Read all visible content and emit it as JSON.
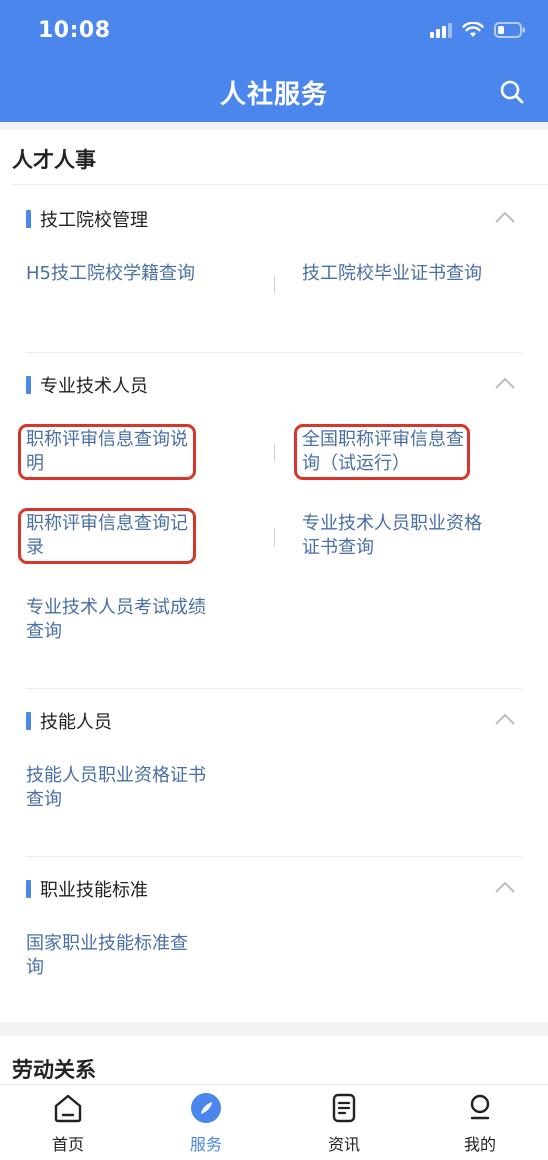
{
  "status_bar": {
    "time": "10:08"
  },
  "header": {
    "title": "人社服务",
    "search_icon": "search-icon"
  },
  "section_talent": {
    "title": "人才人事",
    "groups": [
      {
        "title": "技工院校管理",
        "items": [
          {
            "label": "H5技工院校学籍查询"
          },
          {
            "label": "技工院校毕业证书查询"
          }
        ]
      },
      {
        "title": "专业技术人员",
        "items": [
          {
            "label": "职称评审信息查询说明",
            "highlighted": true
          },
          {
            "label": "全国职称评审信息查询（试运行）",
            "highlighted": true
          },
          {
            "label": "职称评审信息查询记录",
            "highlighted": true
          },
          {
            "label": "专业技术人员职业资格证书查询"
          },
          {
            "label": "专业技术人员考试成绩查询"
          }
        ]
      },
      {
        "title": "技能人员",
        "items": [
          {
            "label": "技能人员职业资格证书查询"
          }
        ]
      },
      {
        "title": "职业技能标准",
        "items": [
          {
            "label": "国家职业技能标准查询"
          }
        ]
      }
    ]
  },
  "section_labor": {
    "title": "劳动关系"
  },
  "tabbar": {
    "active": "服务",
    "tabs": [
      {
        "label": "首页",
        "icon": "home-icon"
      },
      {
        "label": "服务",
        "icon": "compass-icon"
      },
      {
        "label": "资讯",
        "icon": "news-icon"
      },
      {
        "label": "我的",
        "icon": "profile-icon"
      }
    ]
  },
  "colors": {
    "brand": "#4a86ec",
    "link": "#4a6fa5",
    "highlight_border": "#d9362b",
    "background": "#f2f3f5"
  }
}
